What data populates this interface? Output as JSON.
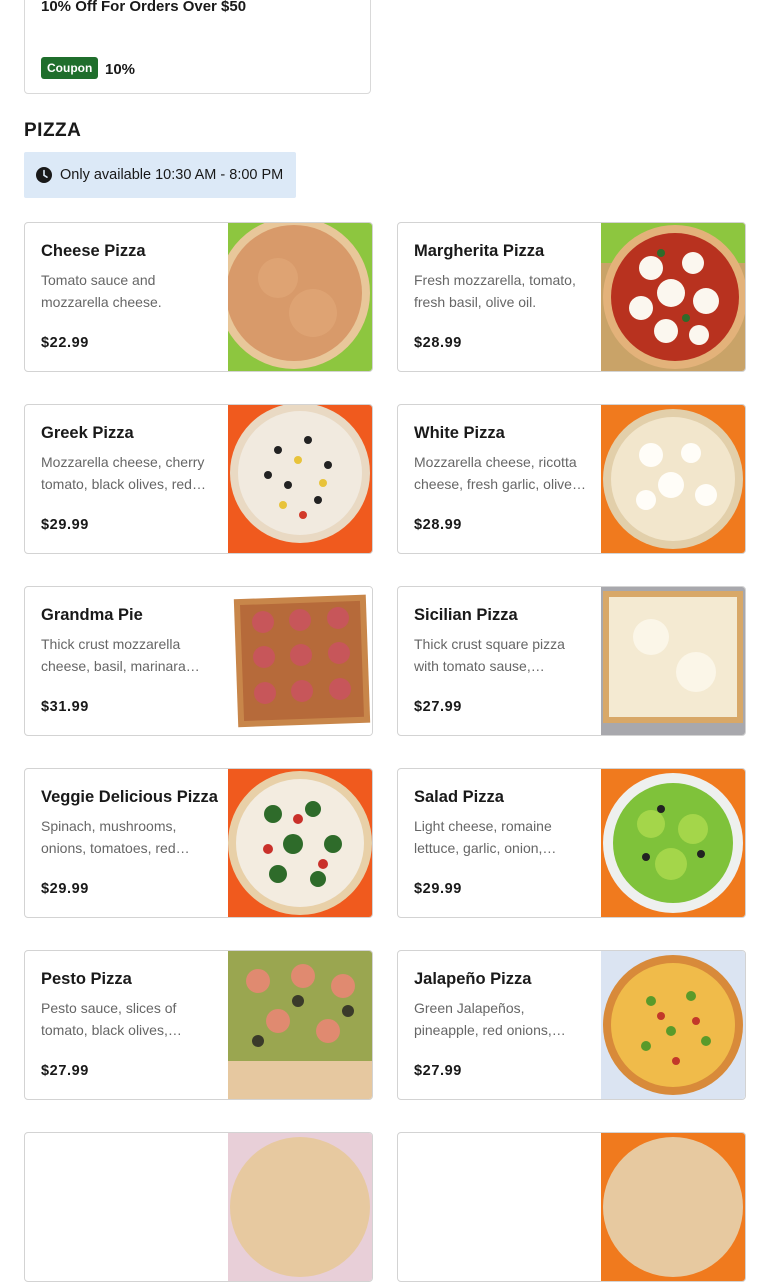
{
  "coupon": {
    "title": "10% Off For Orders Over $50",
    "badge": "Coupon",
    "value": "10%"
  },
  "section": {
    "title": "PIZZA",
    "availability": "Only available 10:30 AM - 8:00 PM"
  },
  "items": [
    {
      "name": "Cheese Pizza",
      "description": "Tomato sauce and mozzarella cheese.",
      "price": "$22.99"
    },
    {
      "name": "Margherita Pizza",
      "description": "Fresh mozzarella, tomato, fresh basil, olive oil.",
      "price": "$28.99"
    },
    {
      "name": "Greek Pizza",
      "description": "Mozzarella cheese, cherry tomato, black olives, red onions, feta cheese.",
      "price": "$29.99"
    },
    {
      "name": "White Pizza",
      "description": "Mozzarella cheese, ricotta cheese, fresh garlic, olive oil.",
      "price": "$28.99"
    },
    {
      "name": "Grandma Pie",
      "description": "Thick crust mozzarella cheese, basil, marinara sauce.",
      "price": "$31.99"
    },
    {
      "name": "Sicilian Pizza",
      "description": "Thick crust square pizza with tomato sause, mozzarella cheese.",
      "price": "$27.99"
    },
    {
      "name": "Veggie Delicious Pizza",
      "description": "Spinach, mushrooms, onions, tomatoes, red peppers, broccoli.",
      "price": "$29.99"
    },
    {
      "name": "Salad Pizza",
      "description": "Light cheese, romaine lettuce, garlic, onion, tomato, black olives.",
      "price": "$29.99"
    },
    {
      "name": "Pesto Pizza",
      "description": "Pesto sauce, slices of tomato, black olives, mozzarella cheese.",
      "price": "$27.99"
    },
    {
      "name": "Jalapeño Pizza",
      "description": "Green Jalapeños, pineapple, red onions, mozzarella cheese.",
      "price": "$27.99"
    },
    {
      "name": "",
      "description": "",
      "price": ""
    },
    {
      "name": "",
      "description": "",
      "price": ""
    }
  ],
  "colors": {
    "coupon_badge": "#1f6e2c",
    "availability_bg": "#dce9f7",
    "card_border": "#d3d3d3"
  }
}
